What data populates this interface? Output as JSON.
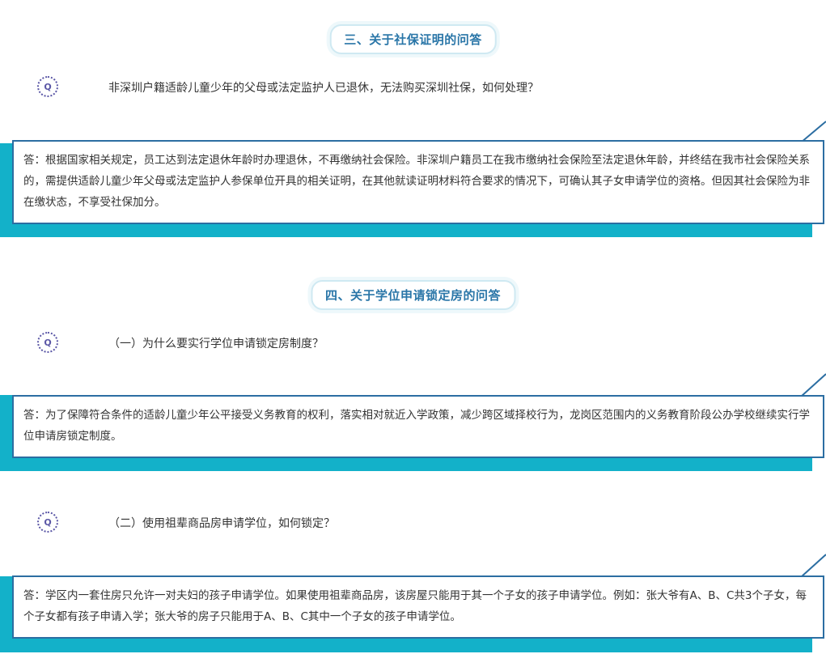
{
  "sections": [
    {
      "title": "三、关于社保证明的问答",
      "qa": [
        {
          "q_icon": "Q",
          "question": "非深圳户籍适龄儿童少年的父母或法定监护人已退休，无法购买深圳社保，如何处理？",
          "answer": "答：根据国家相关规定，员工达到法定退休年龄时办理退休，不再缴纳社会保险。非深圳户籍员工在我市缴纳社会保险至法定退休年龄，并终结在我市社会保险关系的，需提供适龄儿童少年父母或法定监护人参保单位开具的相关证明，在其他就读证明材料符合要求的情况下，可确认其子女申请学位的资格。但因其社会保险为非在缴状态，不享受社保加分。"
        }
      ]
    },
    {
      "title": "四、关于学位申请锁定房的问答",
      "qa": [
        {
          "q_icon": "Q",
          "question": "（一）为什么要实行学位申请锁定房制度？",
          "answer": "答：为了保障符合条件的适龄儿童少年公平接受义务教育的权利，落实相对就近入学政策，减少跨区域择校行为，龙岗区范围内的义务教育阶段公办学校继续实行学位申请房锁定制度。"
        },
        {
          "q_icon": "Q",
          "question": "（二）使用祖辈商品房申请学位，如何锁定？",
          "answer": "答：学区内一套住房只允许一对夫妇的孩子申请学位。如果使用祖辈商品房，该房屋只能用于其一个子女的孩子申请学位。例如：张大爷有A、B、C共3个子女，每个子女都有孩子申请入学；张大爷的房子只能用于A、B、C其中一个子女的孩子申请学位。"
        }
      ]
    }
  ],
  "colors": {
    "accent_teal": "#13b1c9",
    "border_blue": "#2c6ea2",
    "title_blue": "#2a76a8",
    "q_icon_purple": "#5b57a6"
  }
}
